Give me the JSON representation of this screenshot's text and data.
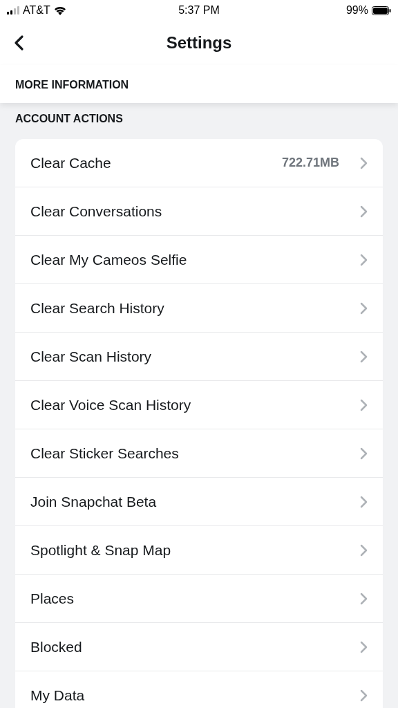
{
  "status_bar": {
    "carrier": "AT&T",
    "time": "5:37 PM",
    "battery": "99%"
  },
  "header": {
    "title": "Settings"
  },
  "sections": [
    {
      "title": "MORE INFORMATION"
    },
    {
      "title": "ACCOUNT ACTIONS",
      "items": [
        {
          "label": "Clear Cache",
          "value": "722.71MB"
        },
        {
          "label": "Clear Conversations"
        },
        {
          "label": "Clear My Cameos Selfie"
        },
        {
          "label": "Clear Search History"
        },
        {
          "label": "Clear Scan History"
        },
        {
          "label": "Clear Voice Scan History"
        },
        {
          "label": "Clear Sticker Searches"
        },
        {
          "label": "Join Snapchat Beta"
        },
        {
          "label": "Spotlight & Snap Map"
        },
        {
          "label": "Places"
        },
        {
          "label": "Blocked"
        },
        {
          "label": "My Data"
        }
      ]
    }
  ]
}
